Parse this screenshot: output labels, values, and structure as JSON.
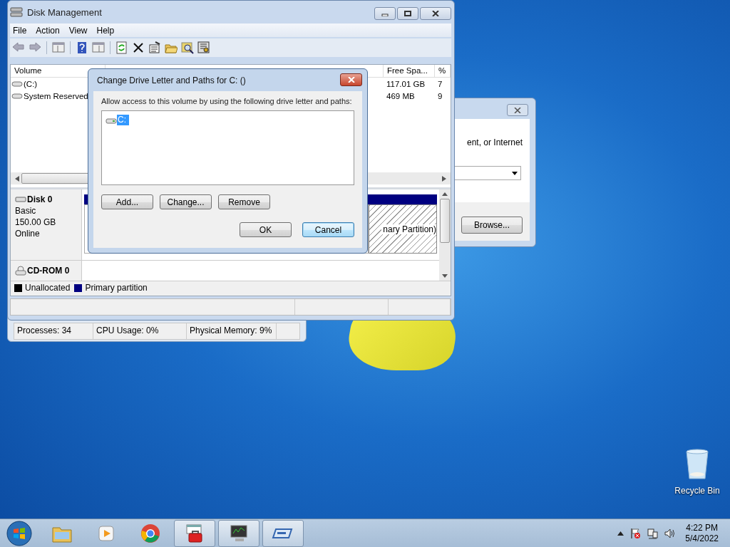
{
  "desktop": {
    "icons": [
      {
        "label": "Recycle Bin"
      }
    ]
  },
  "task_manager": {
    "status_bar": [
      "Processes: 34",
      "CPU Usage: 0%",
      "Physical Memory: 9%"
    ]
  },
  "background_dialog": {
    "text": "ent, or Internet",
    "button": "Browse..."
  },
  "disk_management": {
    "title": "Disk Management",
    "menu": [
      "File",
      "Action",
      "View",
      "Help"
    ],
    "volumes": {
      "columns": [
        "Volume",
        "Free Spa...",
        "%"
      ],
      "rows": [
        {
          "cells": [
            "(C:)",
            "117.01 GB",
            "7"
          ]
        },
        {
          "cells": [
            "System Reserved",
            "469 MB",
            "9"
          ]
        }
      ]
    },
    "disks": [
      {
        "kind": "disk",
        "name": "Disk 0",
        "lines": [
          "Basic",
          "150.00 GB",
          "Online"
        ]
      },
      {
        "kind": "cdrom",
        "name": "CD-ROM 0"
      }
    ],
    "partition_label": "nary Partition)",
    "legend": [
      {
        "label": "Unallocated",
        "color": "#000000"
      },
      {
        "label": "Primary partition",
        "color": "#000080"
      }
    ]
  },
  "dialog": {
    "title": "Change Drive Letter and Paths for C: ()",
    "prompt": "Allow access to this volume by using the following drive letter and paths:",
    "paths": [
      {
        "label": "C:",
        "selected": true
      }
    ],
    "buttons": [
      "Add...",
      "Change...",
      "Remove"
    ],
    "footer_buttons": [
      {
        "label": "OK",
        "focused": false
      },
      {
        "label": "Cancel",
        "focused": true
      }
    ]
  },
  "taskbar": {
    "apps": [
      {
        "kind": "folder",
        "active": false
      },
      {
        "kind": "media",
        "active": false
      },
      {
        "kind": "browser",
        "active": false
      },
      {
        "kind": "toolbox",
        "active": true
      },
      {
        "kind": "monitor",
        "active": true
      },
      {
        "kind": "drive",
        "active": true
      }
    ],
    "time": "4:22 PM",
    "date": "5/4/2022"
  }
}
